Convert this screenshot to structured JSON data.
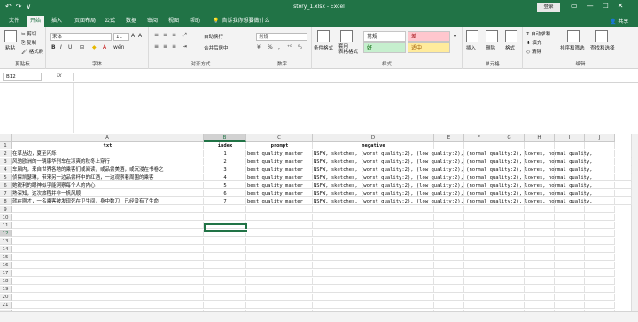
{
  "titlebar": {
    "title": "story_1.xlsx  -  Excel",
    "login_label": "登录",
    "qat": [
      "↶",
      "↷",
      "⊽"
    ],
    "window_buttons": [
      "▭",
      "—",
      "☐",
      "✕"
    ]
  },
  "tabs": {
    "items": [
      "文件",
      "开始",
      "插入",
      "页面布局",
      "公式",
      "数据",
      "审阅",
      "视图",
      "帮助"
    ],
    "active": "开始",
    "tellme": "告诉我你想要做什么",
    "share": "共享"
  },
  "ribbon": {
    "clipboard": {
      "label": "剪贴板",
      "paste": "粘贴",
      "cut": "剪切",
      "copy": "复制",
      "format_painter": "格式刷"
    },
    "font": {
      "label": "字体",
      "font_name": "宋体",
      "font_size": "11"
    },
    "alignment": {
      "label": "对齐方式",
      "wrap": "自动换行",
      "merge": "合并后居中"
    },
    "number": {
      "label": "数字",
      "format": "常规",
      "pct": "%",
      "comma": ","
    },
    "styles": {
      "label": "样式",
      "cond_format": "条件格式",
      "table_format": "套用\n表格格式",
      "normal": "常规",
      "bad": "差",
      "good": "好",
      "neutral": "适中"
    },
    "cells": {
      "label": "单元格",
      "insert": "插入",
      "delete": "删除",
      "format": "格式"
    },
    "editing": {
      "label": "编辑",
      "autosum": "自动求和",
      "fill": "填充",
      "clear": "清除",
      "sort": "排序和筛选",
      "find": "查找和选择"
    }
  },
  "formula_bar": {
    "name_box": "B12",
    "fx": "fx",
    "value": ""
  },
  "grid": {
    "columns": [
      "A",
      "B",
      "C",
      "D",
      "E",
      "F",
      "G",
      "H",
      "I",
      "J"
    ],
    "rows": [
      "1",
      "2",
      "3",
      "4",
      "5",
      "6",
      "7",
      "8",
      "9",
      "10",
      "11",
      "12",
      "13",
      "14",
      "15",
      "16",
      "17",
      "18",
      "19",
      "20",
      "21",
      "22"
    ],
    "selected_cell": "B12",
    "header_row": [
      "txt",
      "index",
      "prompt",
      "negative"
    ],
    "data_rows": [
      {
        "a": "在草丛边，夏至闪烁",
        "b": "1",
        "c": "best quality,master",
        "d": "NSFW, sketches, (worst quality:2), (low quality:2), (normal quality:2), lowres, normal quality,"
      },
      {
        "a": "风驰欧洲的一辆康华列车在凉爽的秋冬上穿行",
        "b": "2",
        "c": "best quality,master",
        "d": "NSFW, sketches, (worst quality:2), (low quality:2), (normal quality:2), lowres, normal quality,"
      },
      {
        "a": "车厢内，来自世界各地的乘客们或阅读，或品尝美酒，或沉浸在书卷之",
        "b": "3",
        "c": "best quality,master",
        "d": "NSFW, sketches, (worst quality:2), (low quality:2), (normal quality:2), lowres, normal quality,"
      },
      {
        "a": "侦探凯瑟琳，带来另一边品尝杯中的红酒，一边观察着周围的乘客",
        "b": "4",
        "c": "best quality,master",
        "d": "NSFW, sketches, (worst quality:2), (low quality:2), (normal quality:2), lowres, normal quality,"
      },
      {
        "a": "她锐利的眼神似乎能洞察每个人的内心",
        "b": "5",
        "c": "best quality,master",
        "d": "NSFW, sketches, (worst quality:2), (low quality:2), (normal quality:2), lowres, normal quality,"
      },
      {
        "a": "熟深知，这次旅程并非一帆风顺",
        "b": "6",
        "c": "best quality,master",
        "d": "NSFW, sketches, (worst quality:2), (low quality:2), (normal quality:2), lowres, normal quality,"
      },
      {
        "a": "就在刚才，一名乘客被发现死在卫生间，身中数刀，已经没有了生命",
        "b": "7",
        "c": "best quality,master",
        "d": "NSFW, sketches, (worst quality:2), (low quality:2), (normal quality:2), lowres, normal quality,"
      }
    ]
  },
  "colors": {
    "excel_green": "#217346",
    "bad_bg": "#ffc7ce",
    "good_bg": "#c6efce",
    "neutral_bg": "#ffeb9c"
  }
}
